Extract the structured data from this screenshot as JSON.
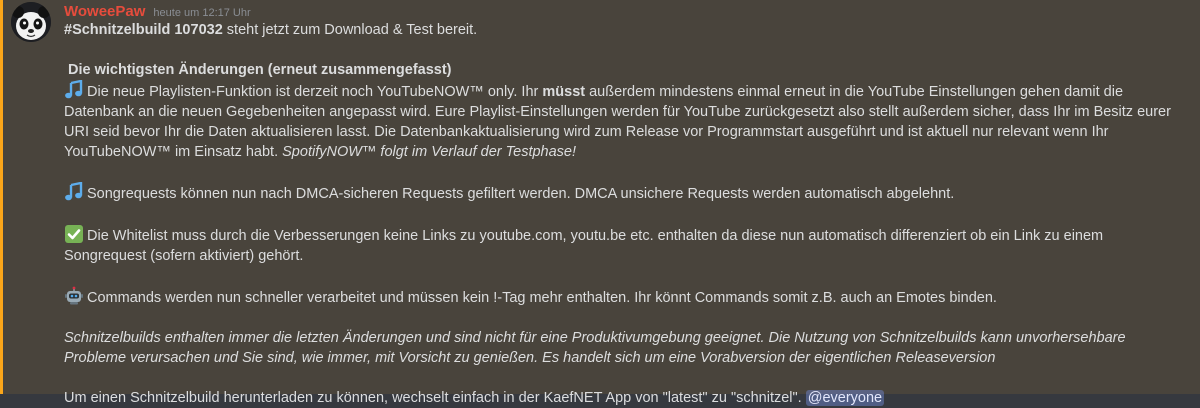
{
  "message": {
    "username": "WoweePaw",
    "timestamp": "heute um 12:17 Uhr",
    "intro": {
      "tag": "#Schnitzelbuild 107032",
      "rest": " steht jetzt zum Download & Test bereit."
    },
    "heading": "Die wichtigsten Änderungen (erneut zusammengefasst)",
    "item1": {
      "icon": "music-note-icon",
      "part1": "Die neue Playlisten-Funktion ist derzeit noch YouTubeNOW™ only. Ihr ",
      "bold": "müsst",
      "part2": " außerdem mindestens einmal erneut in die YouTube Einstellungen gehen damit die Datenbank an die neuen Gegebenheiten angepasst wird. Eure Playlist-Einstellungen werden für YouTube zurückgesetzt also stellt außerdem sicher, dass Ihr im Besitz eurer URI seid bevor Ihr die Daten aktualisieren lasst. Die Datenbankaktualisierung wird zum Release vor Programmstart ausgeführt und ist aktuell nur relevant wenn Ihr YouTubeNOW™ im Einsatz habt. ",
      "italic": "SpotifyNOW™ folgt im Verlauf der Testphase!"
    },
    "item2": {
      "icon": "music-note-icon",
      "text": "Songrequests können nun nach DMCA-sicheren Requests gefiltert werden. DMCA unsichere Requests werden automatisch abgelehnt."
    },
    "item3": {
      "icon": "check-mark-icon",
      "text": "Die Whitelist muss durch die Verbesserungen keine Links zu youtube.com, youtu.be etc. enthalten da diese nun automatisch differenziert ob ein Link zu einem Songrequest (sofern aktiviert) gehört."
    },
    "item4": {
      "icon": "robot-icon",
      "text": "Commands werden nun schneller verarbeitet und müssen kein !-Tag mehr enthalten. Ihr könnt Commands somit z.B. auch an Emotes binden."
    },
    "disclaimer": "Schnitzelbuilds enthalten immer die letzten Änderungen und sind nicht für eine Produktivumgebung geeignet. Die Nutzung von Schnitzelbuilds kann unvorhersehbare Probleme verursachen und Sie sind, wie immer, mit Vorsicht zu genießen. Es handelt sich um eine Vorabversion der eigentlichen Releaseversion",
    "footer": {
      "text": "Um einen Schnitzelbuild herunterladen zu können, wechselt einfach in der KaefNET App von \"latest\" zu \"schnitzel\". ",
      "mention": "@everyone"
    }
  },
  "colors": {
    "background": "#36393f",
    "highlight_background": "#49443c",
    "highlight_bar": "#faa61a",
    "username": "#e74c3c",
    "text": "#dcddde",
    "mention_bg": "#7289da"
  }
}
